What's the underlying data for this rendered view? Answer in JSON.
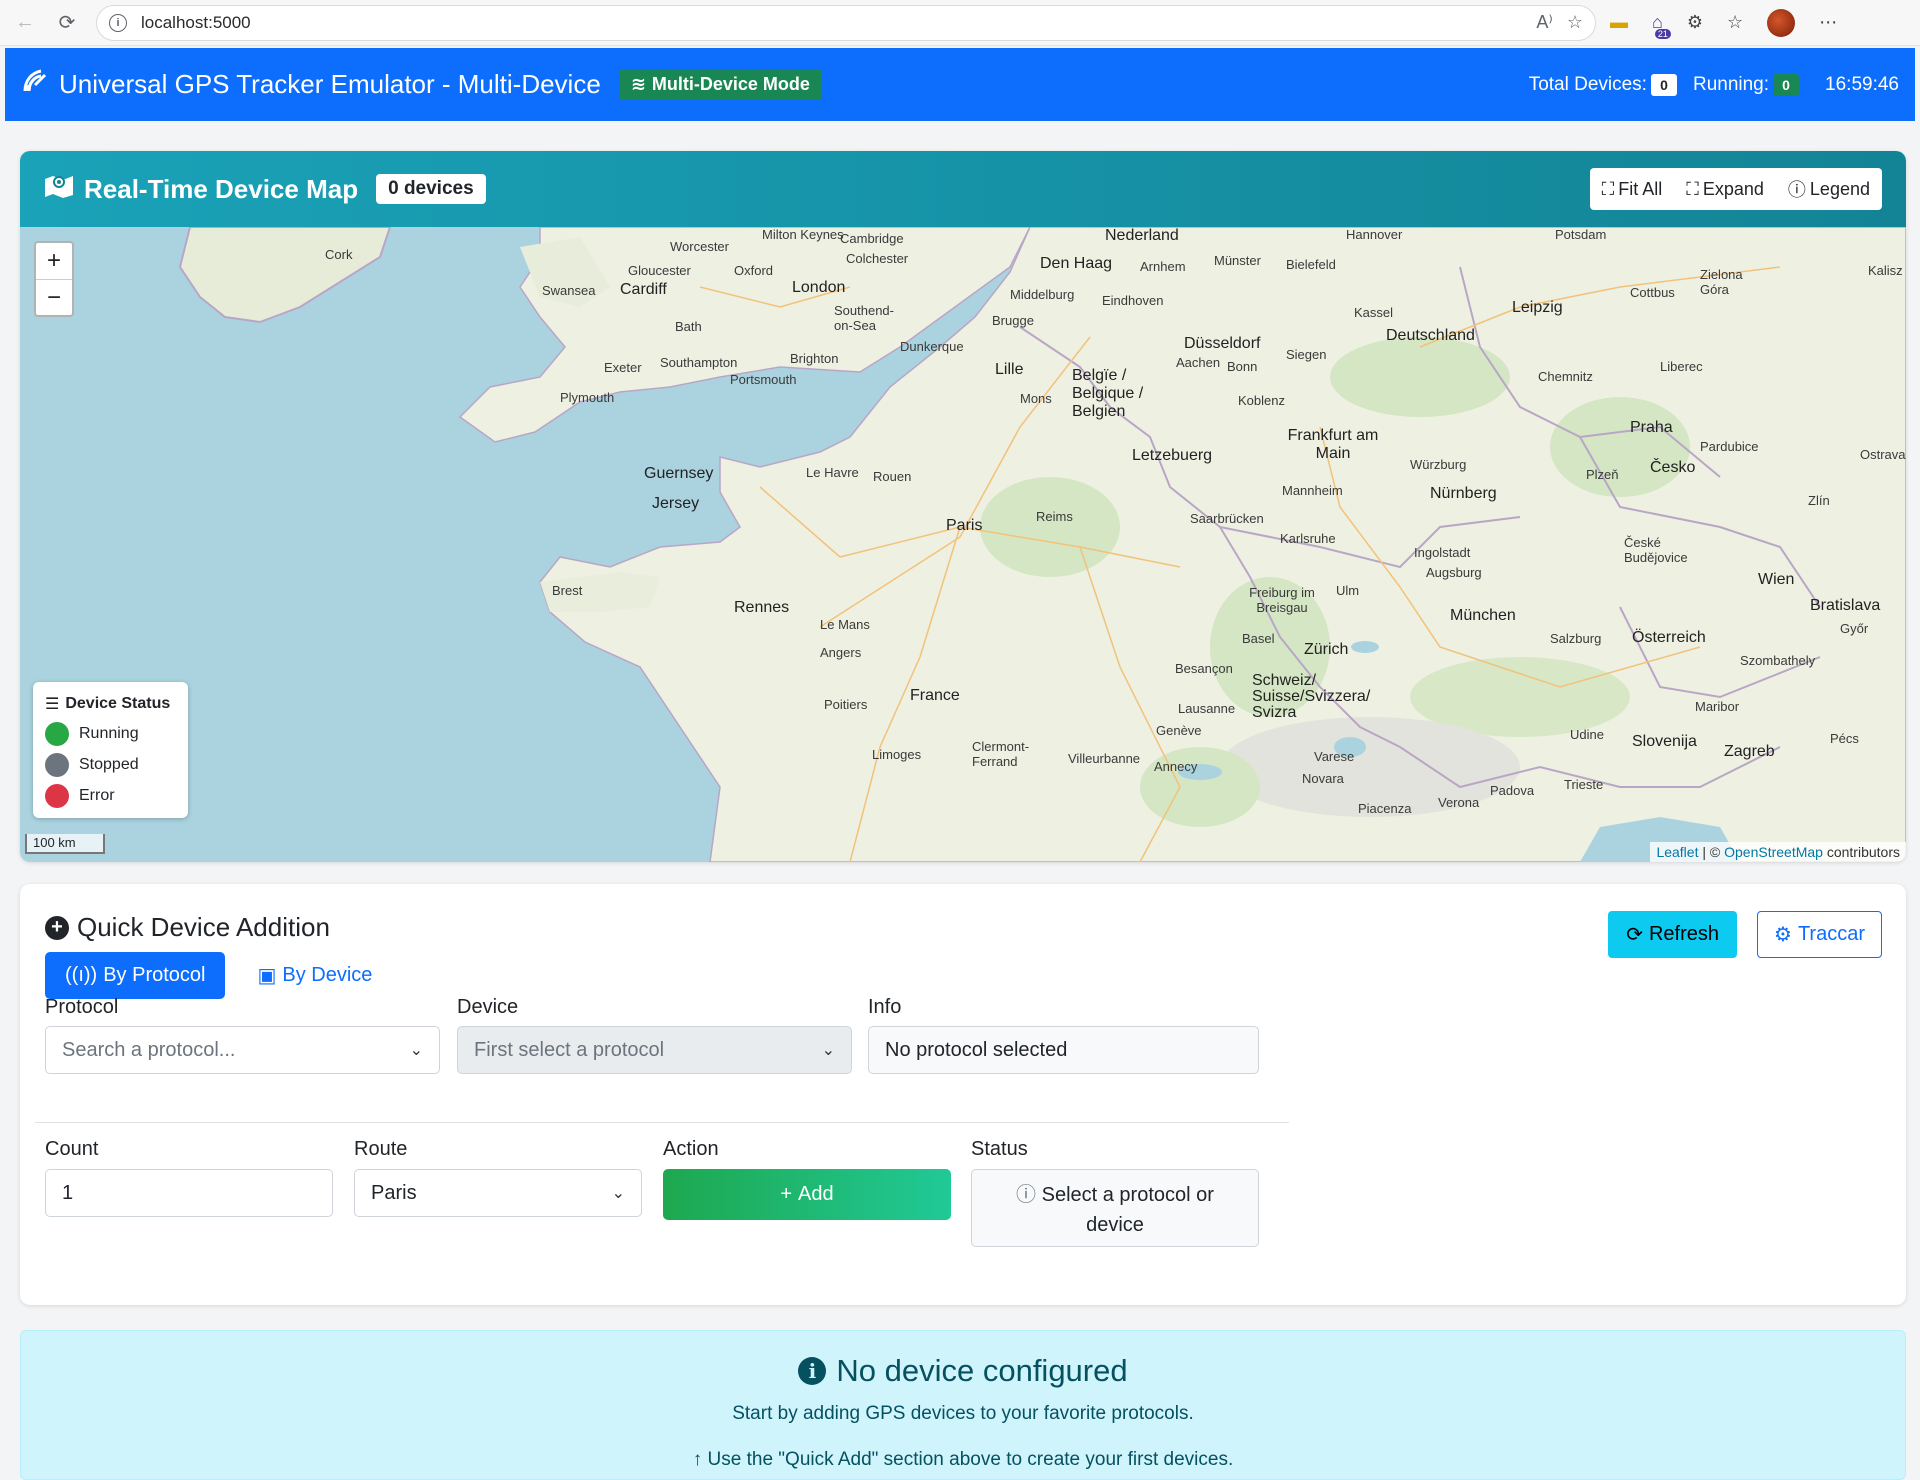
{
  "browser": {
    "url": "localhost:5000",
    "extension_badge": "21"
  },
  "header": {
    "title": "Universal GPS Tracker Emulator - Multi-Device",
    "mode_badge": "Multi-Device Mode",
    "total_devices_label": "Total Devices:",
    "total_devices": "0",
    "running_label": "Running:",
    "running": "0",
    "clock": "16:59:46",
    "colors": {
      "primary": "#0d6efd",
      "success": "#198754"
    }
  },
  "map": {
    "title": "Real-Time Device Map",
    "device_count": "0 devices",
    "tools": {
      "fit_all": "Fit All",
      "expand": "Expand",
      "legend": "Legend"
    },
    "zoom_in": "+",
    "zoom_out": "−",
    "scale": "100 km",
    "attribution": {
      "leaflet": "Leaflet",
      "sep": " | © ",
      "osm": "OpenStreetMap",
      "suffix": " contributors"
    },
    "legend": {
      "title": "Device Status",
      "items": [
        {
          "label": "Running",
          "color": "#28a745"
        },
        {
          "label": "Stopped",
          "color": "#6c757d"
        },
        {
          "label": "Error",
          "color": "#dc3545"
        }
      ]
    },
    "place_labels": [
      "Cork",
      "Worcester",
      "Milton Keynes",
      "Cambridge",
      "Colchester",
      "Gloucester",
      "Oxford",
      "Swansea",
      "Cardiff",
      "London",
      "Southend-on-Sea",
      "Bath",
      "Exeter",
      "Southampton",
      "Brighton",
      "Portsmouth",
      "Plymouth",
      "Nederland",
      "Den Haag",
      "Arnhem",
      "Münster",
      "Bielefeld",
      "Hannover",
      "Middelburg",
      "Eindhoven",
      "Brugge",
      "Dunkerque",
      "Lille",
      "Düsseldorf",
      "Aachen",
      "Bonn",
      "Siegen",
      "Kassel",
      "Deutschland",
      "Leipzig",
      "Potsdam",
      "Cottbus",
      "Zielona Góra",
      "Chemnitz",
      "Liberec",
      "Praha",
      "Pardubice",
      "Belgïe / Belgique / Belgien",
      "Mons",
      "Koblenz",
      "Frankfurt am Main",
      "Würzburg",
      "Plzeň",
      "Česko",
      "Guernsey",
      "Jersey",
      "Le Havre",
      "Rouen",
      "Letzebuerg",
      "Mannheim",
      "Nürnberg",
      "Zlín",
      "Paris",
      "Reims",
      "Saarbrücken",
      "Karlsruhe",
      "Ingolstadt",
      "Augsburg",
      "České Budějovice",
      "Brest",
      "Rennes",
      "Le Mans",
      "Freiburg im Breisgau",
      "Ulm",
      "München",
      "Wien",
      "Bratislava",
      "Basel",
      "Zürich",
      "Salzburg",
      "Österreich",
      "Angers",
      "Besançon",
      "Schweiz/ Suisse/Svizzera/ Svizra",
      "Szombathely",
      "France",
      "Lausanne",
      "Győr",
      "Poitiers",
      "Genève",
      "Maribor",
      "Limoges",
      "Clermont-Ferrand",
      "Villeurbanne",
      "Annecy",
      "Varese",
      "Udine",
      "Slovenija",
      "Zagreb",
      "Novara",
      "Trieste",
      "Padova",
      "Verona",
      "Piacenza",
      "Pécs",
      "Ostrava",
      "Kalisz"
    ]
  },
  "quick_add": {
    "title": "Quick Device Addition",
    "refresh": "Refresh",
    "traccar": "Traccar",
    "tabs": [
      {
        "label": "By Protocol",
        "active": true
      },
      {
        "label": "By Device",
        "active": false
      }
    ],
    "protocol_label": "Protocol",
    "protocol_placeholder": "Search a protocol...",
    "device_label": "Device",
    "device_placeholder": "First select a protocol",
    "info_label": "Info",
    "info_value": "No protocol selected",
    "count_label": "Count",
    "count_value": "1",
    "route_label": "Route",
    "route_value": "Paris",
    "action_label": "Action",
    "add_button": "Add",
    "status_label": "Status",
    "status_value": "Select a protocol or device"
  },
  "empty_state": {
    "title": "No device configured",
    "line1": "Start by adding GPS devices to your favorite protocols.",
    "line2": "Use the \"Quick Add\" section above to create your first devices."
  }
}
